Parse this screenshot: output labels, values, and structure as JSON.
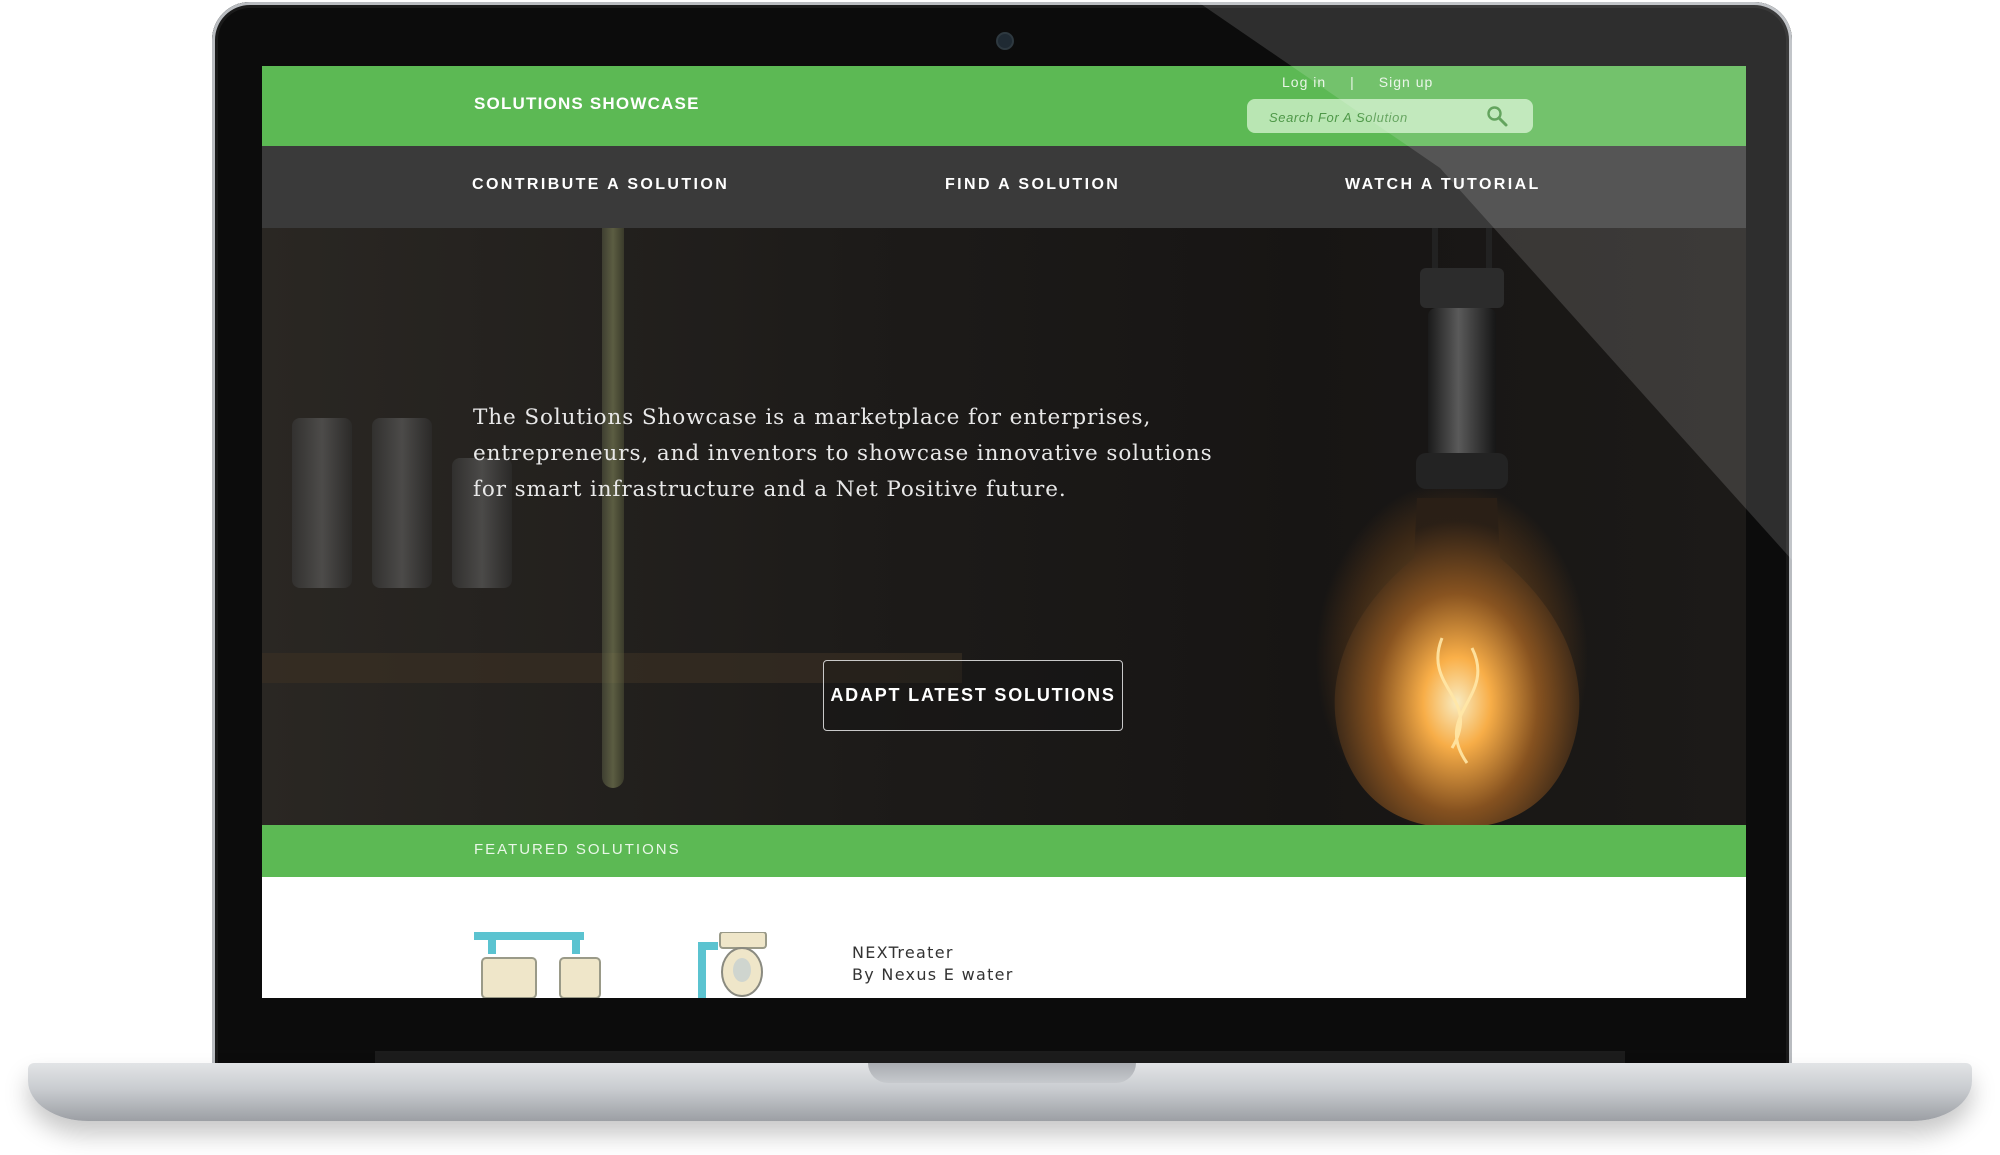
{
  "site": {
    "brand": "SOLUTIONS SHOWCASE",
    "auth": {
      "login": "Log in",
      "separator": "|",
      "signup": "Sign up"
    },
    "search": {
      "placeholder": "Search For A Solution",
      "icon": "search-icon"
    }
  },
  "nav": {
    "items": [
      {
        "label": "CONTRIBUTE A SOLUTION"
      },
      {
        "label": "FIND A SOLUTION"
      },
      {
        "label": "WATCH A TUTORIAL"
      }
    ]
  },
  "hero": {
    "text": "The Solutions Showcase is a marketplace for enterprises, entrepreneurs, and inventors to showcase innovative solutions for smart infrastructure and a Net Positive future.",
    "button_label": "ADAPT LATEST SOLUTIONS"
  },
  "featured": {
    "section_label": "FEATURED SOLUTIONS",
    "items": [
      {
        "title": "NEXTreater",
        "by": "By Nexus E water"
      }
    ]
  },
  "colors": {
    "brand_green": "#5cb954",
    "nav_dark": "#3a3a3a",
    "search_bg": "#b9e6b3"
  }
}
